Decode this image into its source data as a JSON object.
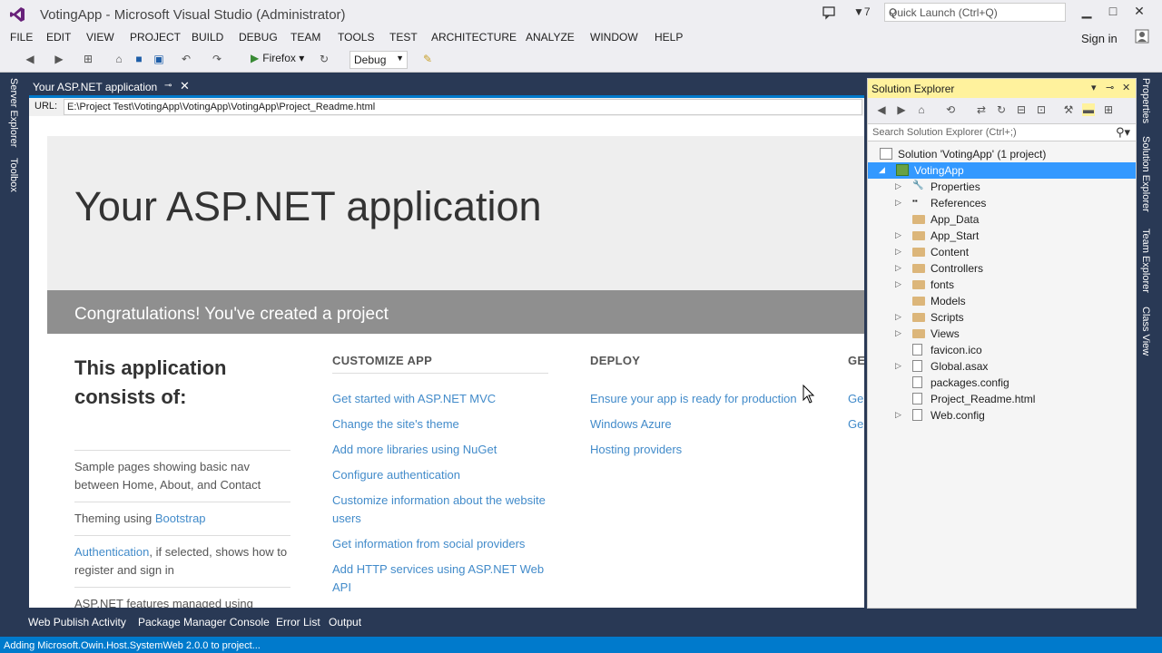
{
  "window": {
    "title": "VotingApp - Microsoft Visual Studio (Administrator)",
    "notification_count": "7",
    "quick_launch_placeholder": "Quick Launch (Ctrl+Q)",
    "minimize": "▁",
    "maximize": "□",
    "close": "✕"
  },
  "menu": [
    "FILE",
    "EDIT",
    "VIEW",
    "PROJECT",
    "BUILD",
    "DEBUG",
    "TEAM",
    "TOOLS",
    "TEST",
    "ARCHITECTURE",
    "ANALYZE",
    "WINDOW",
    "HELP"
  ],
  "signin": "Sign in",
  "toolbar": {
    "run_target": "Firefox",
    "configuration": "Debug"
  },
  "left_tabs": [
    "Server Explorer",
    "Toolbox"
  ],
  "right_tabs": [
    "Properties",
    "Solution Explorer",
    "Team Explorer",
    "Class View"
  ],
  "document": {
    "tab_label": "Your ASP.NET application",
    "url_label": "URL:",
    "url": "E:\\Project Test\\VotingApp\\VotingApp\\VotingApp\\Project_Readme.html"
  },
  "page": {
    "title": "Your ASP.NET application",
    "congrats": "Congratulations! You've created a project",
    "col1_heading": "This application consists of:",
    "col1_items": [
      {
        "text": "Sample pages showing basic nav between Home, About, and Contact"
      },
      {
        "prefix": "Theming using ",
        "link": "Bootstrap",
        "suffix": ""
      },
      {
        "prefix": "",
        "link": "Authentication",
        "suffix": ", if selected, shows how to register and sign in"
      },
      {
        "text": "ASP.NET features managed using"
      }
    ],
    "customize_heading": "CUSTOMIZE APP",
    "customize_links": [
      "Get started with ASP.NET MVC",
      "Change the site's theme",
      "Add more libraries using NuGet",
      "Configure authentication",
      "Customize information about the website users",
      "Get information from social providers",
      "Add HTTP services using ASP.NET Web API"
    ],
    "deploy_heading": "DEPLOY",
    "deploy_links": [
      "Ensure your app is ready for production",
      "Windows Azure",
      "Hosting providers"
    ],
    "col4_heading": "GE",
    "col4_links": [
      "Ge",
      "Ge"
    ]
  },
  "solution_explorer": {
    "title": "Solution Explorer",
    "search_placeholder": "Search Solution Explorer (Ctrl+;)",
    "solution": "Solution 'VotingApp' (1 project)",
    "project": "VotingApp",
    "items": [
      {
        "label": "Properties",
        "type": "properties",
        "expandable": true
      },
      {
        "label": "References",
        "type": "references",
        "expandable": true
      },
      {
        "label": "App_Data",
        "type": "folder",
        "expandable": false
      },
      {
        "label": "App_Start",
        "type": "folder",
        "expandable": true
      },
      {
        "label": "Content",
        "type": "folder",
        "expandable": true
      },
      {
        "label": "Controllers",
        "type": "folder",
        "expandable": true
      },
      {
        "label": "fonts",
        "type": "folder",
        "expandable": true
      },
      {
        "label": "Models",
        "type": "folder",
        "expandable": false
      },
      {
        "label": "Scripts",
        "type": "folder",
        "expandable": true
      },
      {
        "label": "Views",
        "type": "folder",
        "expandable": true
      },
      {
        "label": "favicon.ico",
        "type": "file",
        "expandable": false
      },
      {
        "label": "Global.asax",
        "type": "file",
        "expandable": true
      },
      {
        "label": "packages.config",
        "type": "file",
        "expandable": false
      },
      {
        "label": "Project_Readme.html",
        "type": "file",
        "expandable": false
      },
      {
        "label": "Web.config",
        "type": "file",
        "expandable": true
      }
    ]
  },
  "bottom_tabs": [
    "Web Publish Activity",
    "Package Manager Console",
    "Error List",
    "Output"
  ],
  "status": "Adding Microsoft.Owin.Host.SystemWeb 2.0.0 to project...",
  "colors": {
    "accent": "#007acc",
    "frame": "#293955",
    "link": "#428bca",
    "selection": "#3399ff",
    "se_header": "#fff29d"
  }
}
